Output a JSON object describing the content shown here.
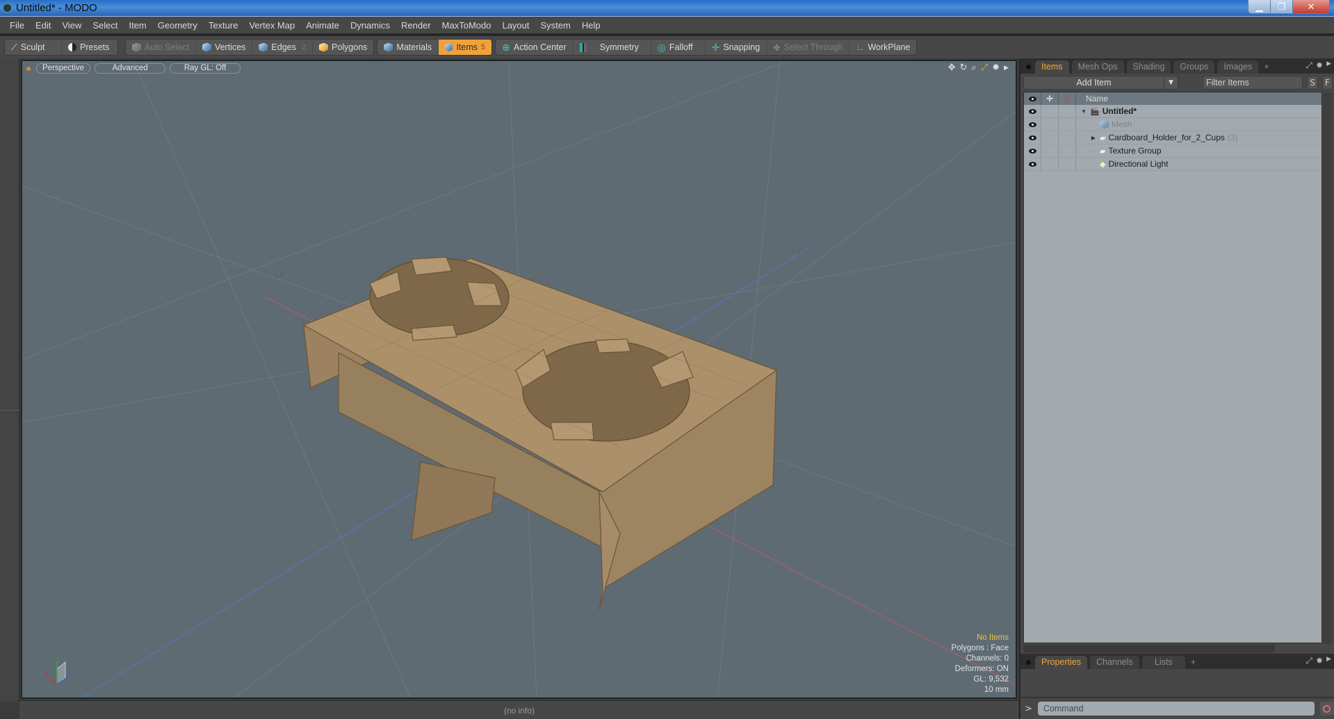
{
  "window": {
    "title": "Untitled* - MODO",
    "controls": [
      "minimize",
      "restore",
      "close"
    ]
  },
  "menu": [
    "File",
    "Edit",
    "View",
    "Select",
    "Item",
    "Geometry",
    "Texture",
    "Vertex Map",
    "Animate",
    "Dynamics",
    "Render",
    "MaxToModo",
    "Layout",
    "System",
    "Help"
  ],
  "toolbar": {
    "sculpt": "Sculpt",
    "presets": "Presets",
    "auto_select": "Auto Select",
    "vertices": "Vertices",
    "edges": "Edges",
    "edges_count": "2",
    "polygons": "Polygons",
    "materials": "Materials",
    "items": "Items",
    "items_count": "5",
    "action_center": "Action Center",
    "symmetry": "Symmetry",
    "falloff": "Falloff",
    "snapping": "Snapping",
    "select_through": "Select Through",
    "workplane": "WorkPlane"
  },
  "viewport": {
    "view_mode": "Perspective",
    "shading": "Advanced",
    "raygl": "Ray GL: Off",
    "axis_labels": {
      "x": "+X",
      "z": "+Z"
    },
    "gizmo": {
      "x": "X",
      "y": "Y",
      "z": "Z"
    },
    "info": {
      "selection": "No Items",
      "polygons": "Polygons : Face",
      "channels": "Channels: 0",
      "deformers": "Deformers: ON",
      "gl": "GL: 9,532",
      "grid": "10 mm"
    },
    "object_color": "#a88c66"
  },
  "status": {
    "text": "(no info)"
  },
  "items_panel": {
    "tabs": [
      "Items",
      "Mesh Ops",
      "Shading",
      "Groups",
      "Images"
    ],
    "active_tab": "Items",
    "add_item": "Add Item",
    "filter_placeholder": "Filter Items",
    "s_button": "S",
    "f_button": "F",
    "name_header": "Name",
    "tree": [
      {
        "name": "Untitled*",
        "icon": "scene-icon",
        "level": 0,
        "expanded": true,
        "bold": true
      },
      {
        "name": "Mesh",
        "icon": "mesh-icon",
        "level": 1,
        "dim": true
      },
      {
        "name": "Cardboard_Holder_for_2_Cups",
        "count": "(3)",
        "icon": "group-icon",
        "level": 1,
        "collapsed": true
      },
      {
        "name": "Texture Group",
        "icon": "group-icon",
        "level": 1
      },
      {
        "name": "Directional Light",
        "icon": "light-icon",
        "level": 1
      }
    ]
  },
  "properties_panel": {
    "tabs": [
      "Properties",
      "Channels",
      "Lists"
    ],
    "active_tab": "Properties"
  },
  "command": {
    "placeholder": "Command",
    "prompt": ">"
  },
  "colors": {
    "accent": "#f0a23a",
    "viewport_bg": "#5f6b72",
    "panel_bg": "#474747"
  }
}
